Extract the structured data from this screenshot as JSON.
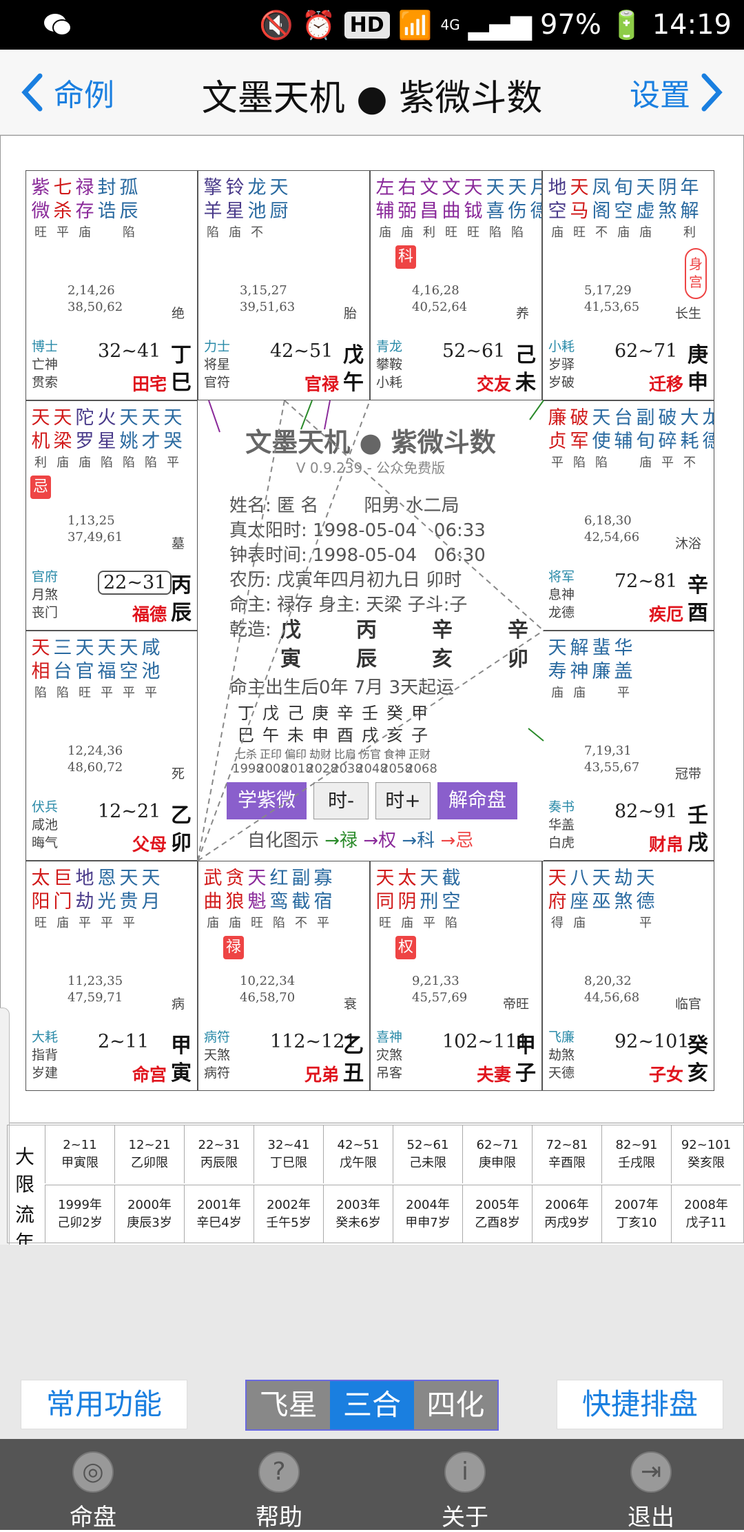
{
  "status": {
    "battery": "97%",
    "time": "14:19",
    "hd": "HD",
    "network": "4G"
  },
  "nav": {
    "back_label": "命例",
    "title": "文墨天机 ● 紫微斗数",
    "settings_label": "设置"
  },
  "cells": [
    {
      "id": "si",
      "stars": [
        [
          "紫",
          "微",
          "旺",
          "purple"
        ],
        [
          "七",
          "杀",
          "平",
          "red"
        ],
        [
          "禄",
          "存",
          "庙",
          "purple"
        ],
        [
          "封",
          "诰",
          "",
          "blue"
        ],
        [
          "孤",
          "辰",
          "陷",
          "blue"
        ]
      ],
      "nums": [
        "2,14,26",
        "38,50,62"
      ],
      "phase": "绝",
      "gods": [
        "博士",
        "亡神",
        "贯索"
      ],
      "daxian": "32~41",
      "palace": "田宅",
      "ganzhi": "丁巳"
    },
    {
      "id": "wu",
      "stars": [
        [
          "擎",
          "羊",
          "陷",
          "black"
        ],
        [
          "铃",
          "星",
          "庙",
          "black"
        ],
        [
          "龙",
          "池",
          "不",
          "blue"
        ],
        [
          "天",
          "厨",
          "",
          "blue"
        ]
      ],
      "nums": [
        "3,15,27",
        "39,51,63"
      ],
      "phase": "胎",
      "gods": [
        "力士",
        "将星",
        "官符"
      ],
      "daxian": "42~51",
      "palace": "官禄",
      "ganzhi": "戊午"
    },
    {
      "id": "wei",
      "stars": [
        [
          "左",
          "辅",
          "庙",
          "purple"
        ],
        [
          "右",
          "弼",
          "庙",
          "purple"
        ],
        [
          "文",
          "昌",
          "利",
          "purple"
        ],
        [
          "文",
          "曲",
          "旺",
          "purple"
        ],
        [
          "天",
          "钺",
          "旺",
          "purple"
        ],
        [
          "天",
          "喜",
          "陷",
          "blue"
        ],
        [
          "天",
          "伤",
          "陷",
          "blue"
        ],
        [
          "月",
          "德",
          "",
          "blue"
        ]
      ],
      "sihua": "科",
      "nums": [
        "4,16,28",
        "40,52,64"
      ],
      "phase": "养",
      "gods": [
        "青龙",
        "攀鞍",
        "小耗"
      ],
      "daxian": "52~61",
      "palace": "交友",
      "ganzhi": "己未"
    },
    {
      "id": "shen",
      "stars": [
        [
          "地",
          "空",
          "庙",
          "black"
        ],
        [
          "天",
          "马",
          "旺",
          "red"
        ],
        [
          "凤",
          "阁",
          "不",
          "blue"
        ],
        [
          "旬",
          "空",
          "庙",
          "blue"
        ],
        [
          "天",
          "虚",
          "庙",
          "blue"
        ],
        [
          "阴",
          "煞",
          "",
          "blue"
        ],
        [
          "年",
          "解",
          "利",
          "blue"
        ]
      ],
      "shen_palace": "身宫",
      "nums": [
        "5,17,29",
        "41,53,65"
      ],
      "phase": "长生",
      "gods": [
        "小耗",
        "岁驿",
        "岁破"
      ],
      "daxian": "62~71",
      "palace": "迁移",
      "ganzhi": "庚申"
    },
    {
      "id": "chen",
      "stars": [
        [
          "天",
          "机",
          "利",
          "red"
        ],
        [
          "天",
          "梁",
          "庙",
          "red"
        ],
        [
          "陀",
          "罗",
          "庙",
          "black"
        ],
        [
          "火",
          "星",
          "陷",
          "black"
        ],
        [
          "天",
          "姚",
          "陷",
          "blue"
        ],
        [
          "天",
          "才",
          "陷",
          "blue"
        ],
        [
          "天",
          "哭",
          "平",
          "blue"
        ]
      ],
      "sihua": "忌",
      "nums": [
        "1,13,25",
        "37,49,61"
      ],
      "phase": "墓",
      "gods": [
        "官府",
        "月煞",
        "丧门"
      ],
      "daxian": "22~31",
      "boxed": true,
      "palace": "福德",
      "ganzhi": "丙辰"
    },
    {
      "id": "you",
      "stars": [
        [
          "廉",
          "贞",
          "平",
          "red"
        ],
        [
          "破",
          "军",
          "陷",
          "red"
        ],
        [
          "天",
          "使",
          "陷",
          "blue"
        ],
        [
          "台",
          "辅",
          "",
          "blue"
        ],
        [
          "副",
          "旬",
          "庙",
          "blue"
        ],
        [
          "破",
          "碎",
          "平",
          "blue"
        ],
        [
          "大",
          "耗",
          "不",
          "blue"
        ],
        [
          "龙",
          "德",
          "",
          "blue"
        ]
      ],
      "nums": [
        "6,18,30",
        "42,54,66"
      ],
      "phase": "沐浴",
      "gods": [
        "将军",
        "息神",
        "龙德"
      ],
      "daxian": "72~81",
      "palace": "疾厄",
      "ganzhi": "辛酉"
    },
    {
      "id": "mao",
      "stars": [
        [
          "天",
          "相",
          "陷",
          "red"
        ],
        [
          "三",
          "台",
          "陷",
          "blue"
        ],
        [
          "天",
          "官",
          "旺",
          "blue"
        ],
        [
          "天",
          "福",
          "平",
          "blue"
        ],
        [
          "天",
          "空",
          "平",
          "blue"
        ],
        [
          "咸",
          "池",
          "平",
          "blue"
        ]
      ],
      "nums": [
        "12,24,36",
        "48,60,72"
      ],
      "phase": "死",
      "gods": [
        "伏兵",
        "咸池",
        "晦气"
      ],
      "daxian": "12~21",
      "palace": "父母",
      "ganzhi": "乙卯"
    },
    {
      "id": "xu",
      "stars": [
        [
          "天",
          "寿",
          "庙",
          "blue"
        ],
        [
          "解",
          "神",
          "庙",
          "blue"
        ],
        [
          "蜚",
          "廉",
          "",
          "blue"
        ],
        [
          "华",
          "盖",
          "平",
          "blue"
        ]
      ],
      "nums": [
        "7,19,31",
        "43,55,67"
      ],
      "phase": "冠带",
      "gods": [
        "奏书",
        "华盖",
        "白虎"
      ],
      "daxian": "82~91",
      "palace": "财帛",
      "ganzhi": "壬戌"
    },
    {
      "id": "yin",
      "stars": [
        [
          "太",
          "阳",
          "旺",
          "red"
        ],
        [
          "巨",
          "门",
          "庙",
          "red"
        ],
        [
          "地",
          "劫",
          "平",
          "black"
        ],
        [
          "恩",
          "光",
          "平",
          "blue"
        ],
        [
          "天",
          "贵",
          "平",
          "blue"
        ],
        [
          "天",
          "月",
          "",
          "blue"
        ]
      ],
      "nums": [
        "11,23,35",
        "47,59,71"
      ],
      "phase": "病",
      "gods": [
        "大耗",
        "指背",
        "岁建"
      ],
      "daxian": "2~11",
      "palace": "命宫",
      "ganzhi": "甲寅"
    },
    {
      "id": "chou",
      "stars": [
        [
          "武",
          "曲",
          "庙",
          "red"
        ],
        [
          "贪",
          "狼",
          "庙",
          "red"
        ],
        [
          "天",
          "魁",
          "旺",
          "purple"
        ],
        [
          "红",
          "鸾",
          "陷",
          "blue"
        ],
        [
          "副",
          "截",
          "不",
          "blue"
        ],
        [
          "寡",
          "宿",
          "平",
          "blue"
        ]
      ],
      "sihua": "禄",
      "nums": [
        "10,22,34",
        "46,58,70"
      ],
      "phase": "衰",
      "gods": [
        "病符",
        "天煞",
        "病符"
      ],
      "daxian": "112~121",
      "palace": "兄弟",
      "ganzhi": "乙丑"
    },
    {
      "id": "zi",
      "stars": [
        [
          "天",
          "同",
          "旺",
          "red"
        ],
        [
          "太",
          "阴",
          "庙",
          "red"
        ],
        [
          "天",
          "刑",
          "平",
          "blue"
        ],
        [
          "截",
          "空",
          "陷",
          "blue"
        ]
      ],
      "sihua": "权",
      "nums": [
        "9,21,33",
        "45,57,69"
      ],
      "phase": "帝旺",
      "gods": [
        "喜神",
        "灾煞",
        "吊客"
      ],
      "daxian": "102~111",
      "palace": "夫妻",
      "ganzhi": "甲子"
    },
    {
      "id": "hai",
      "stars": [
        [
          "天",
          "府",
          "得",
          "red"
        ],
        [
          "八",
          "座",
          "庙",
          "blue"
        ],
        [
          "天",
          "巫",
          "",
          "blue"
        ],
        [
          "劫",
          "煞",
          "",
          "blue"
        ],
        [
          "天",
          "德",
          "平",
          "blue"
        ]
      ],
      "nums": [
        "8,20,32",
        "44,56,68"
      ],
      "phase": "临官",
      "gods": [
        "飞廉",
        "劫煞",
        "天德"
      ],
      "daxian": "92~101",
      "palace": "子女",
      "ganzhi": "癸亥"
    }
  ],
  "center": {
    "title": "文墨天机 ● 紫微斗数",
    "version": "V 0.9.239 - 公众免费版",
    "name_line": "姓名: 匿 名        阳男 水二局",
    "sun_time": "真太阳时: 1998-05-04   06:33",
    "clock_time": "钟表时间: 1998-05-04   06:30",
    "lunar": "农历: 戊寅年四月初九日 卯时",
    "ming": "命主: 禄存 身主: 天梁 子斗:子",
    "qianzao_label": "乾造:",
    "pillars_top": [
      "戊",
      "丙",
      "辛",
      "辛"
    ],
    "pillars_bottom": [
      "寅",
      "辰",
      "亥",
      "卯"
    ],
    "yun": "命主出生后0年 7月 3天起运",
    "stems": [
      "丁",
      "戊",
      "己",
      "庚",
      "辛",
      "壬",
      "癸",
      "甲"
    ],
    "branches": [
      "巳",
      "午",
      "未",
      "申",
      "酉",
      "戌",
      "亥",
      "子"
    ],
    "shishen": [
      "七杀",
      "正印",
      "偏印",
      "劫财",
      "比肩",
      "伤官",
      "食神",
      "正财"
    ],
    "years": [
      "1998",
      "2008",
      "2018",
      "2028",
      "2038",
      "2048",
      "2058",
      "2068"
    ],
    "btn_xue": "学紫微",
    "btn_minus": "时-",
    "btn_plus": "时+",
    "btn_jie": "解命盘",
    "legend_prefix": "自化图示",
    "legend_lu": "→禄",
    "legend_quan": "→权",
    "legend_ke": "→科",
    "legend_ji": "→忌"
  },
  "timeline": {
    "daxian_label": "大限",
    "liunian_label": "流年",
    "daxian": [
      [
        "2~11",
        "甲寅限"
      ],
      [
        "12~21",
        "乙卯限"
      ],
      [
        "22~31",
        "丙辰限"
      ],
      [
        "32~41",
        "丁巳限"
      ],
      [
        "42~51",
        "戊午限"
      ],
      [
        "52~61",
        "己未限"
      ],
      [
        "62~71",
        "庚申限"
      ],
      [
        "72~81",
        "辛酉限"
      ],
      [
        "82~91",
        "壬戌限"
      ],
      [
        "92~101",
        "癸亥限"
      ]
    ],
    "liunian": [
      [
        "1999年",
        "己卯2岁"
      ],
      [
        "2000年",
        "庚辰3岁"
      ],
      [
        "2001年",
        "辛巳4岁"
      ],
      [
        "2002年",
        "壬午5岁"
      ],
      [
        "2003年",
        "癸未6岁"
      ],
      [
        "2004年",
        "甲申7岁"
      ],
      [
        "2005年",
        "乙酉8岁"
      ],
      [
        "2006年",
        "丙戌9岁"
      ],
      [
        "2007年",
        "丁亥10"
      ],
      [
        "2008年",
        "戊子11"
      ]
    ]
  },
  "bottom": {
    "common": "常用功能",
    "seg": [
      "飞星",
      "三合",
      "四化"
    ],
    "seg_active": 1,
    "quick": "快捷排盘"
  },
  "tabs": [
    "命盘",
    "帮助",
    "关于",
    "退出"
  ],
  "colors": {
    "accent": "#1a7fe0",
    "red": "#e0141d",
    "purple": "#8a5fcc"
  }
}
